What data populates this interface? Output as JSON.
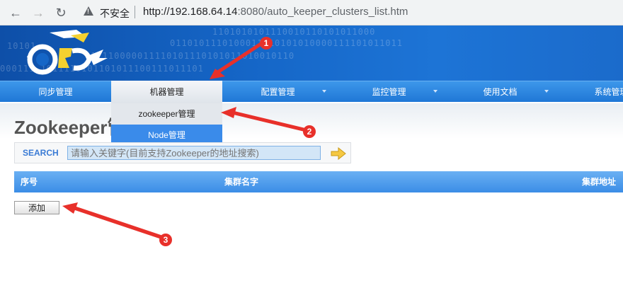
{
  "browser": {
    "insecure_label": "不安全",
    "url_host": "http://192.168.64.14",
    "url_rest": ":8080/auto_keeper_clusters_list.htm"
  },
  "navbar": {
    "items": [
      {
        "label": "同步管理"
      },
      {
        "label": "机器管理"
      },
      {
        "label": "配置管理"
      },
      {
        "label": "监控管理"
      },
      {
        "label": "使用文档"
      },
      {
        "label": "系统管理"
      }
    ]
  },
  "dropdown": {
    "items": [
      {
        "label": "zookeeper管理"
      },
      {
        "label": "Node管理"
      }
    ]
  },
  "page": {
    "title": "Zookeeper管"
  },
  "search": {
    "label": "SEARCH",
    "placeholder": "请输入关键字(目前支持Zookeeper的地址搜索)"
  },
  "table": {
    "columns": [
      "序号",
      "集群名字",
      "集群地址"
    ]
  },
  "actions": {
    "add_label": "添加"
  },
  "annotations": {
    "markers": [
      "1",
      "2",
      "3"
    ],
    "color": "#e8302a"
  },
  "colors": {
    "banner": "#1566c7",
    "navbar": "#2f86e0",
    "dropdown_active": "#3a8bea"
  }
}
